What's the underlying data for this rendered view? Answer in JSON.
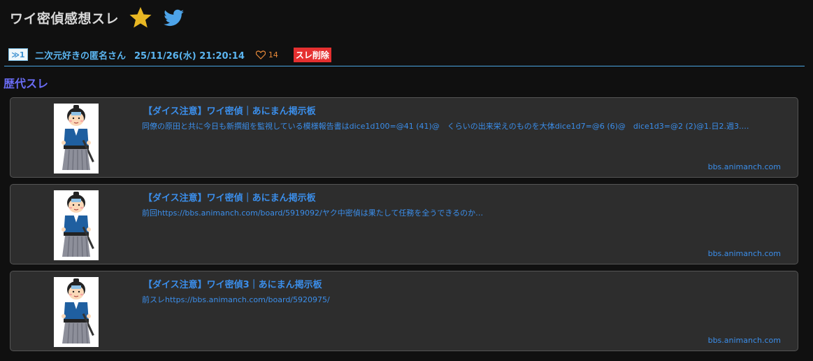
{
  "header": {
    "title": "ワイ密偵感想スレ",
    "star_icon": "star-icon",
    "twitter_icon": "twitter-icon",
    "star_color": "#e8b723",
    "twitter_color": "#4da3e8"
  },
  "post": {
    "number": "≫1",
    "name": "二次元好きの匿名さん",
    "date": "25/11/26(水) 21:20:14",
    "like_icon": "heart-icon",
    "like_count": "14",
    "delete_label": "スレ削除"
  },
  "section": {
    "heading": "歴代スレ"
  },
  "cards": [
    {
      "title": "【ダイス注意】ワイ密偵｜あにまん掲示板",
      "desc": "同僚の原田と共に今日も新撰組を監視している模様報告書はdice1d100=@41 (41)@　くらいの出来栄えのものを大体dice1d7=@6 (6)@　dice1d3=@2 (2)@1.日2.週3.…",
      "domain": "bbs.animanch.com",
      "thumb": "samurai-illustration"
    },
    {
      "title": "【ダイス注意】ワイ密偵｜あにまん掲示板",
      "desc": "前回https://bbs.animanch.com/board/5919092/ヤク中密偵は果たして任務を全うできるのか…",
      "domain": "bbs.animanch.com",
      "thumb": "samurai-illustration"
    },
    {
      "title": "【ダイス注意】ワイ密偵3｜あにまん掲示板",
      "desc": "前スレhttps://bbs.animanch.com/board/5920975/",
      "domain": "bbs.animanch.com",
      "thumb": "samurai-illustration"
    }
  ]
}
